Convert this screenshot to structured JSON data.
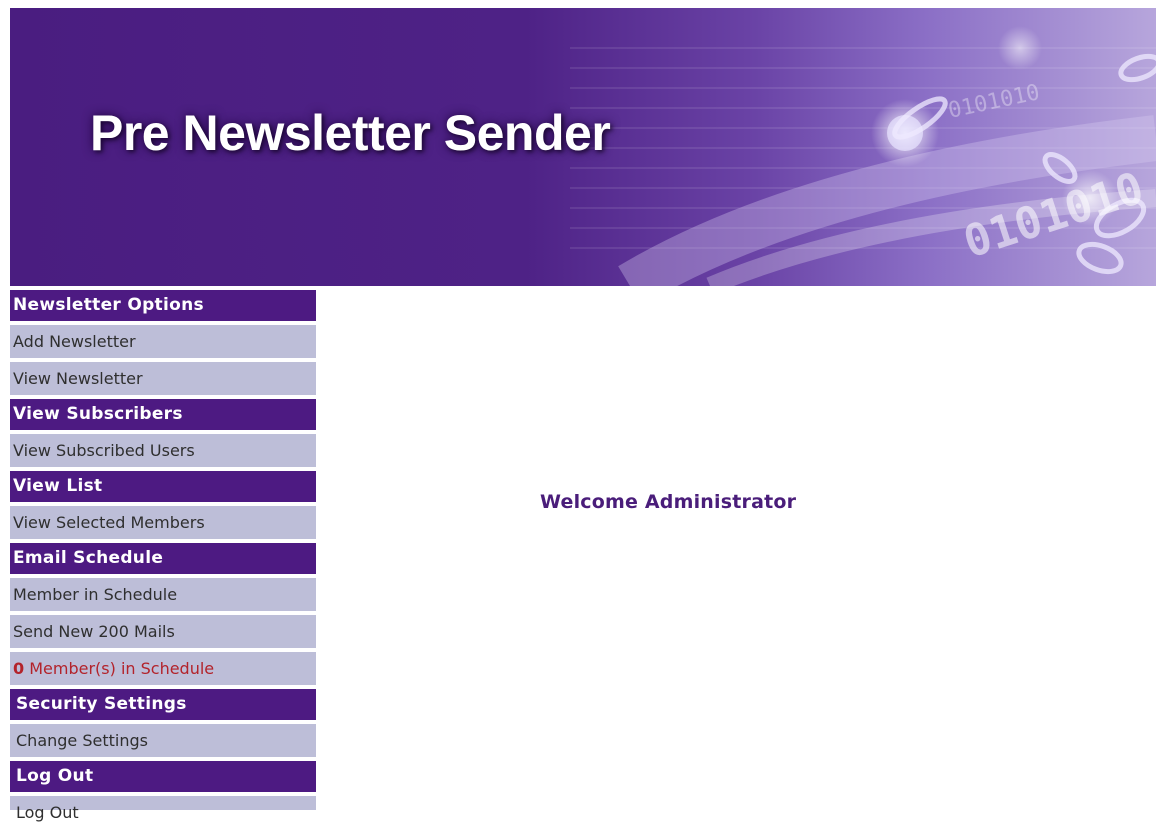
{
  "header": {
    "title": "Pre Newsletter Sender",
    "banner_text": "0101010"
  },
  "sidebar": {
    "sections": [
      {
        "title": "Newsletter Options",
        "items": [
          "Add Newsletter",
          "View Newsletter"
        ]
      },
      {
        "title": "View Subscribers",
        "items": [
          "View Subscribed Users"
        ]
      },
      {
        "title": "View List",
        "items": [
          "View Selected Members"
        ]
      },
      {
        "title": "Email Schedule",
        "items": [
          "Member in Schedule",
          "Send New 200 Mails"
        ],
        "schedule_count": "0",
        "schedule_label": " Member(s) in Schedule"
      },
      {
        "title": "Security Settings",
        "items": [
          "Change Settings"
        ]
      },
      {
        "title": "Log Out",
        "items": [
          "Log Out"
        ]
      }
    ]
  },
  "main": {
    "welcome": "Welcome Administrator"
  },
  "colors": {
    "header_bg": "#4d1a82",
    "item_bg": "#bdbed8",
    "alert_text": "#b3232b",
    "welcome_text": "#4a1d7a"
  }
}
